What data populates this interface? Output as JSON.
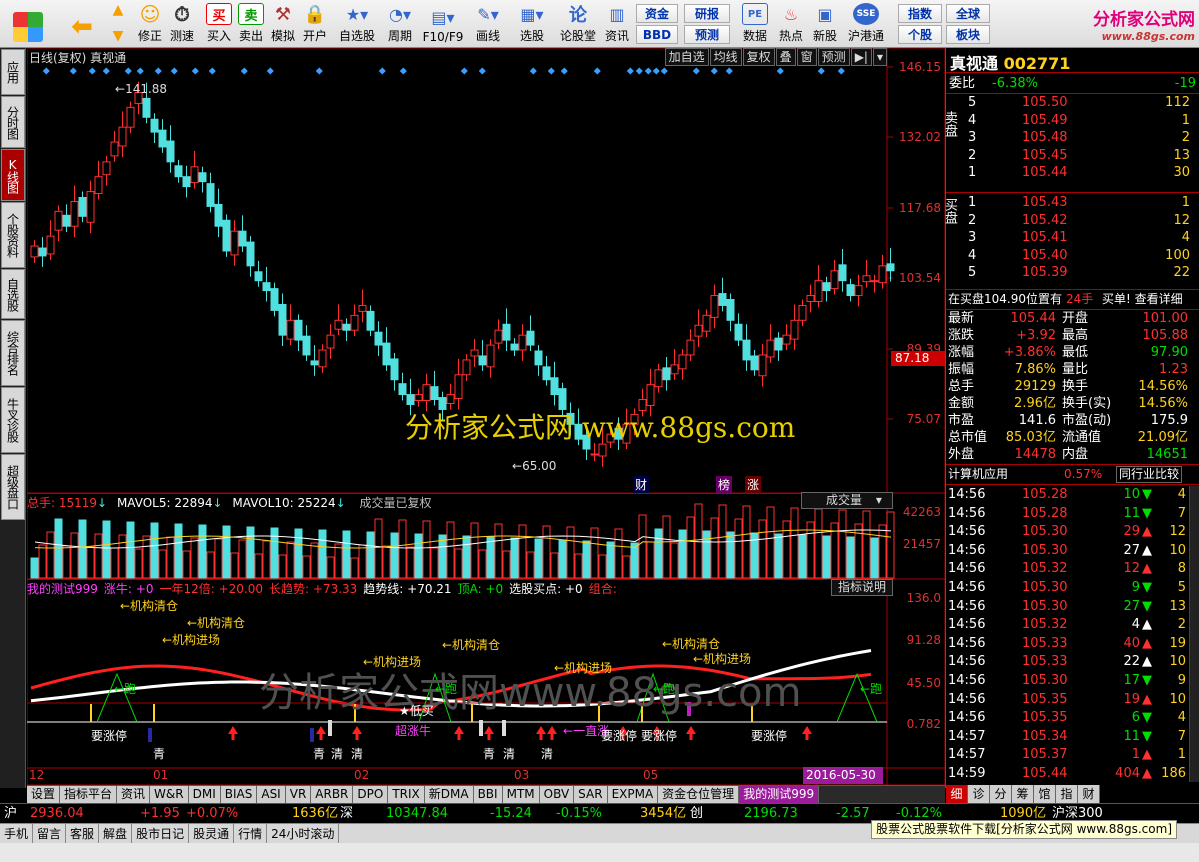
{
  "toolbar": {
    "buttons": [
      "修正",
      "测速",
      "买入",
      "卖出",
      "模拟",
      "开户",
      "自选股",
      "周期",
      "F10/F9",
      "画线",
      "选股",
      "论股堂",
      "资讯",
      "数据",
      "热点",
      "新股",
      "沪港通"
    ],
    "small_buttons": [
      "资金",
      "研报",
      "BBD",
      "预测",
      "指数",
      "全球",
      "个股",
      "板块"
    ],
    "logo_text": "分析家公式网",
    "logo_url": "www.88gs.com"
  },
  "left_tabs": [
    "应用",
    "分时图",
    "K线图",
    "个股资料",
    "自选股",
    "综合排名",
    "牛叉诊股",
    "超级盘口"
  ],
  "chart": {
    "header_left": "日线(复权)  真视通",
    "header_buttons": [
      "加自选",
      "均线",
      "复权",
      "叠",
      "窗",
      "预测"
    ],
    "price_axis": [
      "146.15",
      "132.02",
      "117.68",
      "103.54",
      "89.39",
      "75.07"
    ],
    "current_price_tag": "87.18",
    "high_label": "141.88",
    "low_label": "65.00",
    "markers": [
      "财",
      "榜",
      "涨"
    ],
    "watermark": "分析家公式网  www.88gs.com",
    "watermark2": "分析家公式网www.88gs.com",
    "volume": {
      "header": {
        "zs_label": "总手: 15119",
        "ma5": "MAVOL5: 22894",
        "ma10": "MAVOL10: 25224",
        "note": "成交量已复权"
      },
      "selector": "成交量",
      "axis": [
        "42263",
        "21457"
      ]
    },
    "indicator": {
      "header": [
        {
          "text": "我的测试999",
          "color": "#ff40ff"
        },
        {
          "text": "涨牛: +0",
          "color": "#ff40ff"
        },
        {
          "text": "一年12倍: +20.00",
          "color": "#ff3030"
        },
        {
          "text": "长趋势: +73.33",
          "color": "#ff3030"
        },
        {
          "text": "趋势线: +70.21",
          "color": "#ffffff"
        },
        {
          "text": "顶A: +0",
          "color": "#00dd00"
        },
        {
          "text": "选股买点: +0",
          "color": "#ffffff"
        },
        {
          "text": "组合:",
          "color": "#ff3030"
        }
      ],
      "help_button": "指标说明",
      "axis": [
        "136.0",
        "91.28",
        "45.50",
        "0.782"
      ],
      "labels": {
        "jgqc": "←机构清仓",
        "jgjc": "←机构进场",
        "pao": "←跑",
        "yzt": "要涨停",
        "qing": "清",
        "qing2": "青",
        "dimai": "低买",
        "chaozhangniu": "超涨牛",
        "yizhizhang": "一直涨"
      }
    },
    "dates": [
      "12",
      "01",
      "02",
      "03",
      "05"
    ]
  },
  "bottom_tabs": [
    "设置",
    "指标平台",
    "资讯",
    "W&R",
    "DMI",
    "BIAS",
    "ASI",
    "VR",
    "ARBR",
    "DPO",
    "TRIX",
    "新DMA",
    "BBI",
    "MTM",
    "OBV",
    "SAR",
    "EXPMA",
    "资金仓位管理",
    "我的测试999"
  ],
  "bottom_date": "2016-05-30",
  "quote": {
    "name": "真视通",
    "code": "002771",
    "weibi_label": "委比",
    "weibi": "-6.38%",
    "weicha": "-19",
    "sell_label": "卖盘",
    "buy_label": "买盘",
    "sell": [
      {
        "lv": "5",
        "price": "105.50",
        "vol": "112"
      },
      {
        "lv": "4",
        "price": "105.49",
        "vol": "1"
      },
      {
        "lv": "3",
        "price": "105.48",
        "vol": "2"
      },
      {
        "lv": "2",
        "price": "105.45",
        "vol": "13"
      },
      {
        "lv": "1",
        "price": "105.44",
        "vol": "30"
      }
    ],
    "buy": [
      {
        "lv": "1",
        "price": "105.43",
        "vol": "1"
      },
      {
        "lv": "2",
        "price": "105.42",
        "vol": "12"
      },
      {
        "lv": "3",
        "price": "105.41",
        "vol": "4"
      },
      {
        "lv": "4",
        "price": "105.40",
        "vol": "100"
      },
      {
        "lv": "5",
        "price": "105.39",
        "vol": "22"
      }
    ],
    "inbuy_note": "在买盘104.90位置有",
    "inbuy_vol": "24手",
    "inbuy_more": "买单! 查看详细",
    "stats": [
      {
        "l1": "最新",
        "v1": "105.44",
        "c1": "red",
        "l2": "开盘",
        "v2": "101.00",
        "c2": "red"
      },
      {
        "l1": "涨跌",
        "v1": "+3.92",
        "c1": "red",
        "l2": "最高",
        "v2": "105.88",
        "c2": "red"
      },
      {
        "l1": "涨幅",
        "v1": "+3.86%",
        "c1": "red",
        "l2": "最低",
        "v2": "97.90",
        "c2": "green"
      },
      {
        "l1": "振幅",
        "v1": "7.86%",
        "c1": "yel",
        "l2": "量比",
        "v2": "1.23",
        "c2": "red"
      },
      {
        "l1": "总手",
        "v1": "29129",
        "c1": "yel",
        "l2": "换手",
        "v2": "14.56%",
        "c2": "yel"
      },
      {
        "l1": "金额",
        "v1": "2.96亿",
        "c1": "yel",
        "l2": "换手(实)",
        "v2": "14.56%",
        "c2": "yel"
      },
      {
        "l1": "市盈",
        "v1": "141.6",
        "c1": "wht",
        "l2": "市盈(动)",
        "v2": "175.9",
        "c2": "wht"
      },
      {
        "l1": "总市值",
        "v1": "85.03亿",
        "c1": "yel",
        "l2": "流通值",
        "v2": "21.09亿",
        "c2": "yel"
      },
      {
        "l1": "外盘",
        "v1": "14478",
        "c1": "red",
        "l2": "内盘",
        "v2": "14651",
        "c2": "green"
      }
    ],
    "sector": "计算机应用",
    "sector_chg": "0.57%",
    "sector_link": "同行业比较",
    "ticks": [
      {
        "t": "14:56",
        "p": "105.28",
        "v": "10",
        "d": "down",
        "n": "4"
      },
      {
        "t": "14:56",
        "p": "105.28",
        "v": "11",
        "d": "down",
        "n": "7"
      },
      {
        "t": "14:56",
        "p": "105.30",
        "v": "29",
        "d": "up",
        "n": "12"
      },
      {
        "t": "14:56",
        "p": "105.30",
        "v": "27",
        "d": "upw",
        "n": "10"
      },
      {
        "t": "14:56",
        "p": "105.32",
        "p_c": "red",
        "v": "12",
        "d": "up",
        "n": "8"
      },
      {
        "t": "14:56",
        "p": "105.30",
        "v": "9",
        "d": "down",
        "n": "5"
      },
      {
        "t": "14:56",
        "p": "105.30",
        "v": "27",
        "d": "down",
        "n": "13"
      },
      {
        "t": "14:56",
        "p": "105.32",
        "v": "4",
        "d": "upw",
        "n": "2"
      },
      {
        "t": "14:56",
        "p": "105.33",
        "v": "40",
        "d": "up",
        "n": "19"
      },
      {
        "t": "14:56",
        "p": "105.33",
        "v": "22",
        "d": "upw",
        "n": "10"
      },
      {
        "t": "14:56",
        "p": "105.30",
        "v": "17",
        "d": "down",
        "n": "9"
      },
      {
        "t": "14:56",
        "p": "105.35",
        "v": "19",
        "d": "up",
        "n": "10"
      },
      {
        "t": "14:56",
        "p": "105.35",
        "v": "6",
        "d": "down",
        "n": "4"
      },
      {
        "t": "14:57",
        "p": "105.34",
        "v": "11",
        "d": "down",
        "n": "7"
      },
      {
        "t": "14:57",
        "p": "105.37",
        "v": "1",
        "d": "up",
        "n": "1"
      },
      {
        "t": "14:59",
        "p": "105.44",
        "v": "404",
        "d": "up",
        "n": "186"
      }
    ],
    "right_tabs": [
      "细",
      "诊",
      "分",
      "筹",
      "馆",
      "指",
      "财"
    ]
  },
  "status1": {
    "sh_label": "沪",
    "sh_val": "2936.04",
    "sh_chg": "+1.95",
    "sh_pct": "+0.07%",
    "sh_amt": "1636亿",
    "sz_label": "深",
    "sz_val": "10347.84",
    "sz_chg": "-15.24",
    "sz_pct": "-0.15%",
    "sz_amt": "3454亿",
    "cy_label": "创",
    "cy_val": "2196.73",
    "cy_chg": "-2.57",
    "cy_pct": "-0.12%",
    "cy_amt": "1090亿",
    "hs300": "沪深300"
  },
  "status2": [
    "手机",
    "留言",
    "客服",
    "解盘",
    "股市日记",
    "股灵通",
    "行情",
    "24小时滚动"
  ],
  "download_link": "股票公式股票软件下载[分析家公式网 www.88gs.com]"
}
